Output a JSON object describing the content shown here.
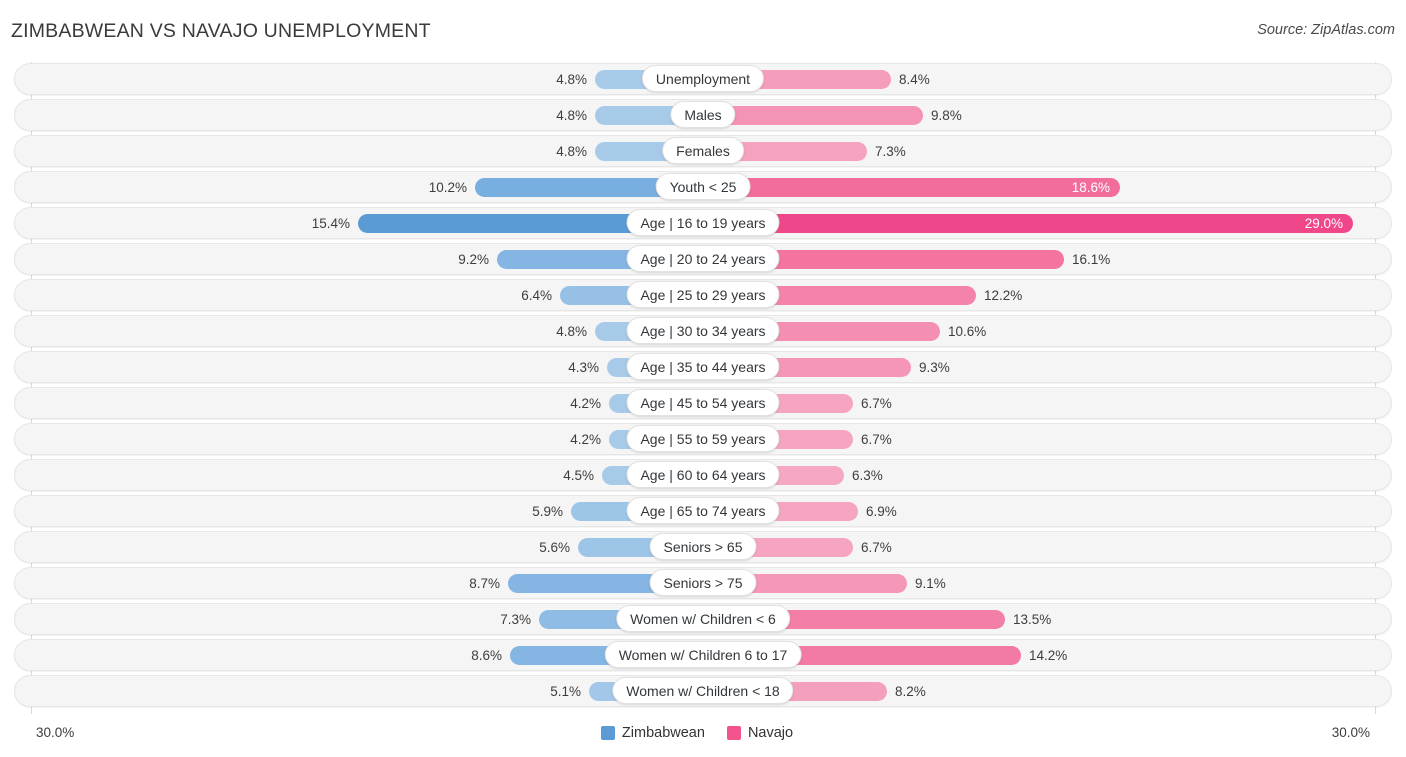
{
  "header": {
    "title": "ZIMBABWEAN VS NAVAJO UNEMPLOYMENT",
    "source": "Source: ZipAtlas.com"
  },
  "footer": {
    "axis_left": "30.0%",
    "axis_right": "30.0%",
    "legend": [
      {
        "label": "Zimbabwean",
        "color": "#5b9bd5"
      },
      {
        "label": "Navajo",
        "color": "#f4548d"
      }
    ]
  },
  "chart_data": {
    "type": "bar",
    "subtype": "diverging-bidirectional",
    "title": "ZIMBABWEAN VS NAVAJO UNEMPLOYMENT",
    "xlabel": "",
    "ylabel": "",
    "axis_max": 30.0,
    "axis_left_label": "30.0%",
    "axis_right_label": "30.0%",
    "grid": false,
    "legend_position": "bottom-center",
    "categories": [
      "Unemployment",
      "Males",
      "Females",
      "Youth < 25",
      "Age | 16 to 19 years",
      "Age | 20 to 24 years",
      "Age | 25 to 29 years",
      "Age | 30 to 34 years",
      "Age | 35 to 44 years",
      "Age | 45 to 54 years",
      "Age | 55 to 59 years",
      "Age | 60 to 64 years",
      "Age | 65 to 74 years",
      "Seniors > 65",
      "Seniors > 75",
      "Women w/ Children < 6",
      "Women w/ Children 6 to 17",
      "Women w/ Children < 18"
    ],
    "series": [
      {
        "name": "Zimbabwean",
        "color": "#5b9bd5",
        "values": [
          4.8,
          4.8,
          4.8,
          10.2,
          15.4,
          9.2,
          6.4,
          4.8,
          4.3,
          4.2,
          4.2,
          4.5,
          5.9,
          5.6,
          8.7,
          7.3,
          8.6,
          5.1
        ],
        "labels": [
          "4.8%",
          "4.8%",
          "4.8%",
          "10.2%",
          "15.4%",
          "9.2%",
          "6.4%",
          "4.8%",
          "4.3%",
          "4.2%",
          "4.2%",
          "4.5%",
          "5.9%",
          "5.6%",
          "8.7%",
          "7.3%",
          "8.6%",
          "5.1%"
        ]
      },
      {
        "name": "Navajo",
        "color": "#f4548d",
        "values": [
          8.4,
          9.8,
          7.3,
          18.6,
          29.0,
          16.1,
          12.2,
          10.6,
          9.3,
          6.7,
          6.7,
          6.3,
          6.9,
          6.7,
          9.1,
          13.5,
          14.2,
          8.2
        ],
        "labels": [
          "8.4%",
          "9.8%",
          "7.3%",
          "18.6%",
          "29.0%",
          "16.1%",
          "12.2%",
          "10.6%",
          "9.3%",
          "6.7%",
          "6.7%",
          "6.3%",
          "6.9%",
          "6.7%",
          "9.1%",
          "13.5%",
          "14.2%",
          "8.2%"
        ]
      }
    ]
  },
  "rows": [
    {
      "label": "Unemployment",
      "left_value": 4.8,
      "left_label": "4.8%",
      "right_value": 8.4,
      "right_label": "8.4%",
      "left_color": "#a8cae9",
      "right_color": "#f59dbd",
      "left_inside": false,
      "right_inside": false
    },
    {
      "label": "Males",
      "left_value": 4.8,
      "left_label": "4.8%",
      "right_value": 9.8,
      "right_label": "9.8%",
      "left_color": "#a8cae9",
      "right_color": "#f593b6",
      "left_inside": false,
      "right_inside": false
    },
    {
      "label": "Females",
      "left_value": 4.8,
      "left_label": "4.8%",
      "right_value": 7.3,
      "right_label": "7.3%",
      "left_color": "#a8cae9",
      "right_color": "#f5a2c0",
      "left_inside": false,
      "right_inside": false
    },
    {
      "label": "Youth < 25",
      "left_value": 10.2,
      "left_label": "10.2%",
      "right_value": 18.6,
      "right_label": "18.6%",
      "left_color": "#79aee0",
      "right_color": "#f26d9c",
      "left_inside": false,
      "right_inside": true
    },
    {
      "label": "Age | 16 to 19 years",
      "left_value": 15.4,
      "left_label": "15.4%",
      "right_value": 29.0,
      "right_label": "29.0%",
      "left_color": "#5b9bd5",
      "right_color": "#f0478a",
      "left_inside": false,
      "right_inside": true
    },
    {
      "label": "Age | 20 to 24 years",
      "left_value": 9.2,
      "left_label": "9.2%",
      "right_value": 16.1,
      "right_label": "16.1%",
      "left_color": "#84b5e3",
      "right_color": "#f2749f",
      "left_inside": false,
      "right_inside": false
    },
    {
      "label": "Age | 25 to 29 years",
      "left_value": 6.4,
      "left_label": "6.4%",
      "right_value": 12.2,
      "right_label": "12.2%",
      "left_color": "#96c0e6",
      "right_color": "#f383ab",
      "left_inside": false,
      "right_inside": false
    },
    {
      "label": "Age | 30 to 34 years",
      "left_value": 4.8,
      "left_label": "4.8%",
      "right_value": 10.6,
      "right_label": "10.6%",
      "left_color": "#a8cae9",
      "right_color": "#f48fb3",
      "left_inside": false,
      "right_inside": false
    },
    {
      "label": "Age | 35 to 44 years",
      "left_value": 4.3,
      "left_label": "4.3%",
      "right_value": 9.3,
      "right_label": "9.3%",
      "left_color": "#a8cae9",
      "right_color": "#f596b8",
      "left_inside": false,
      "right_inside": false
    },
    {
      "label": "Age | 45 to 54 years",
      "left_value": 4.2,
      "left_label": "4.2%",
      "right_value": 6.7,
      "right_label": "6.7%",
      "left_color": "#a8cae9",
      "right_color": "#f5a5c2",
      "left_inside": false,
      "right_inside": false
    },
    {
      "label": "Age | 55 to 59 years",
      "left_value": 4.2,
      "left_label": "4.2%",
      "right_value": 6.7,
      "right_label": "6.7%",
      "left_color": "#a8cae9",
      "right_color": "#f5a5c2",
      "left_inside": false,
      "right_inside": false
    },
    {
      "label": "Age | 60 to 64 years",
      "left_value": 4.5,
      "left_label": "4.5%",
      "right_value": 6.3,
      "right_label": "6.3%",
      "left_color": "#a8cae9",
      "right_color": "#f5a7c4",
      "left_inside": false,
      "right_inside": false
    },
    {
      "label": "Age | 65 to 74 years",
      "left_value": 5.9,
      "left_label": "5.9%",
      "right_value": 6.9,
      "right_label": "6.9%",
      "left_color": "#9dc5e8",
      "right_color": "#f5a4c1",
      "left_inside": false,
      "right_inside": false
    },
    {
      "label": "Seniors > 65",
      "left_value": 5.6,
      "left_label": "5.6%",
      "right_value": 6.7,
      "right_label": "6.7%",
      "left_color": "#9dc5e8",
      "right_color": "#f5a5c2",
      "left_inside": false,
      "right_inside": false
    },
    {
      "label": "Seniors > 75",
      "left_value": 8.7,
      "left_label": "8.7%",
      "right_value": 9.1,
      "right_label": "9.1%",
      "left_color": "#84b5e3",
      "right_color": "#f597b9",
      "left_inside": false,
      "right_inside": false
    },
    {
      "label": "Women w/ Children < 6",
      "left_value": 7.3,
      "left_label": "7.3%",
      "right_value": 13.5,
      "right_label": "13.5%",
      "left_color": "#8fbce5",
      "right_color": "#f37eA8",
      "left_inside": false,
      "right_inside": false
    },
    {
      "label": "Women w/ Children 6 to 17",
      "left_value": 8.6,
      "left_label": "8.6%",
      "right_value": 14.2,
      "right_label": "14.2%",
      "left_color": "#84b5e3",
      "right_color": "#f37aa5",
      "left_inside": false,
      "right_inside": false
    },
    {
      "label": "Women w/ Children < 18",
      "left_value": 5.1,
      "left_label": "5.1%",
      "right_value": 8.2,
      "right_label": "8.2%",
      "left_color": "#a3c7e8",
      "right_color": "#f59fbe",
      "left_inside": false,
      "right_inside": false
    }
  ]
}
